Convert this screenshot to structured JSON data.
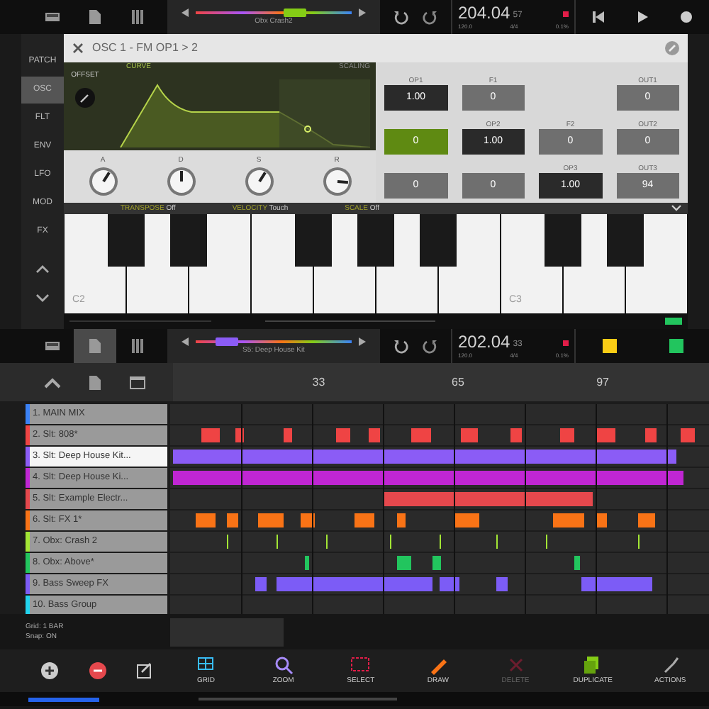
{
  "top_bar": {
    "track_name": "Obx Crash2",
    "time": "204.04",
    "time_sub": "57",
    "tempo": "120.0",
    "signature": "4/4",
    "cpu": "0.1%"
  },
  "synth": {
    "sidebar": [
      {
        "label": "PATCH",
        "selected": false
      },
      {
        "label": "OSC",
        "selected": true
      },
      {
        "label": "FLT",
        "selected": false
      },
      {
        "label": "ENV",
        "selected": false
      },
      {
        "label": "LFO",
        "selected": false
      },
      {
        "label": "MOD",
        "selected": false
      },
      {
        "label": "FX",
        "selected": false
      }
    ],
    "title": "OSC 1 - FM OP1 > 2",
    "curve_label": "CURVE",
    "scaling_label": "SCALING",
    "offset_label": "OFFSET",
    "knobs": [
      {
        "label": "A",
        "level": 0.62
      },
      {
        "label": "D",
        "level": 0.5
      },
      {
        "label": "S",
        "level": 0.62
      },
      {
        "label": "R",
        "level": 0.85
      }
    ],
    "matrix": [
      [
        {
          "header": "OP1",
          "value": "1.00",
          "kind": "op"
        },
        {
          "header": "F1",
          "value": "0",
          "kind": "plain"
        },
        {
          "kind": "empty"
        },
        {
          "header": "OUT1",
          "value": "0",
          "kind": "plain"
        }
      ],
      [
        {
          "value": "0",
          "kind": "active"
        },
        {
          "header": "OP2",
          "value": "1.00",
          "kind": "op"
        },
        {
          "header": "F2",
          "value": "0",
          "kind": "plain"
        },
        {
          "header": "OUT2",
          "value": "0",
          "kind": "plain"
        }
      ],
      [
        {
          "value": "0",
          "kind": "plain"
        },
        {
          "value": "0",
          "kind": "plain"
        },
        {
          "header": "OP3",
          "value": "1.00",
          "kind": "op"
        },
        {
          "header": "OUT3",
          "value": "94",
          "kind": "plain"
        }
      ]
    ]
  },
  "keyboard": {
    "settings": [
      {
        "name": "TRANSPOSE",
        "value": "Off"
      },
      {
        "name": "VELOCITY",
        "value": "Touch"
      },
      {
        "name": "SCALE",
        "value": "Off"
      }
    ],
    "octave_labels": [
      "C2",
      "C3"
    ]
  },
  "arranger_bar": {
    "track_name": "S5: Deep House Kit",
    "time": "202.04",
    "time_sub": "33",
    "tempo": "120.0",
    "signature": "4/4",
    "cpu": "0.1%"
  },
  "ruler": [
    "33",
    "65",
    "97"
  ],
  "tracks": [
    {
      "name": "1. MAIN MIX",
      "color": "#3b82f6",
      "selected": false
    },
    {
      "name": "2. Slt: 808*",
      "color": "#ef4444",
      "selected": false
    },
    {
      "name": "3. Slt: Deep House Kit...",
      "color": "#8b5cf6",
      "selected": true
    },
    {
      "name": "4. Slt: Deep House Ki...",
      "color": "#c026d3",
      "selected": false
    },
    {
      "name": "5. Slt: Example Electr...",
      "color": "#e5484d",
      "selected": false
    },
    {
      "name": "6. Slt: FX 1*",
      "color": "#f97316",
      "selected": false
    },
    {
      "name": "7. Obx: Crash 2",
      "color": "#a3e635",
      "selected": false
    },
    {
      "name": "8. Obx: Above*",
      "color": "#22c55e",
      "selected": false
    },
    {
      "name": "9. Bass Sweep FX",
      "color": "#7c5cf6",
      "selected": false
    },
    {
      "name": "10. Bass Group",
      "color": "#22d3ee",
      "selected": false
    }
  ],
  "grid_info": [
    "Grid: 1 BAR",
    "Snap: ON"
  ],
  "tools": [
    {
      "label": "GRID",
      "disabled": false
    },
    {
      "label": "ZOOM",
      "disabled": false
    },
    {
      "label": "SELECT",
      "disabled": false
    },
    {
      "label": "DRAW",
      "disabled": false
    },
    {
      "label": "DELETE",
      "disabled": true
    },
    {
      "label": "DUPLICATE",
      "disabled": false
    },
    {
      "label": "ACTIONS",
      "disabled": false
    }
  ]
}
